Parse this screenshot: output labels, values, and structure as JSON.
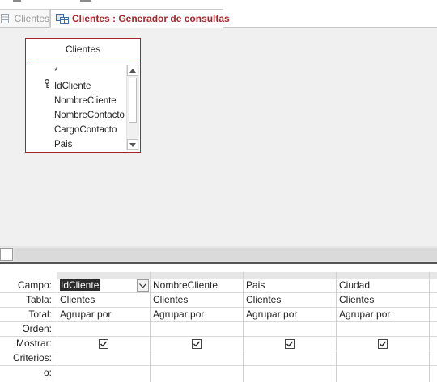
{
  "tabs": [
    {
      "label": "Clientes",
      "active": false
    },
    {
      "label": "Clientes : Generador de consultas",
      "active": true
    }
  ],
  "table_box": {
    "title": "Clientes",
    "fields": [
      {
        "label": "*",
        "primary_key": false
      },
      {
        "label": "IdCliente",
        "primary_key": true
      },
      {
        "label": "NombreCliente",
        "primary_key": false
      },
      {
        "label": "NombreContacto",
        "primary_key": false
      },
      {
        "label": "CargoContacto",
        "primary_key": false
      },
      {
        "label": "Pais",
        "primary_key": false
      }
    ]
  },
  "grid": {
    "row_labels": {
      "campo": "Campo:",
      "tabla": "Tabla:",
      "total": "Total:",
      "orden": "Orden:",
      "mostrar": "Mostrar:",
      "criterios": "Criterios:",
      "o": "o:"
    },
    "columns": [
      {
        "campo": "IdCliente",
        "tabla": "Clientes",
        "total": "Agrupar por",
        "orden": "",
        "mostrar": true,
        "criterios": "",
        "o": ""
      },
      {
        "campo": "NombreCliente",
        "tabla": "Clientes",
        "total": "Agrupar por",
        "orden": "",
        "mostrar": true,
        "criterios": "",
        "o": ""
      },
      {
        "campo": "Pais",
        "tabla": "Clientes",
        "total": "Agrupar por",
        "orden": "",
        "mostrar": true,
        "criterios": "",
        "o": ""
      },
      {
        "campo": "Ciudad",
        "tabla": "Clientes",
        "total": "Agrupar por",
        "orden": "",
        "mostrar": true,
        "criterios": "",
        "o": ""
      },
      {
        "campo": "",
        "tabla": "",
        "total": "",
        "orden": "",
        "mostrar": false,
        "criterios": "",
        "o": ""
      }
    ]
  },
  "colors": {
    "accent": "#a4262c",
    "design_bg": "#f0f0f0",
    "selection": "#2b2b2b"
  },
  "icons": {
    "active_tab": "query-designer-icon",
    "inactive_tab": "table-icon",
    "primary_key": "key-icon",
    "dropdown": "chevron-down-icon"
  }
}
